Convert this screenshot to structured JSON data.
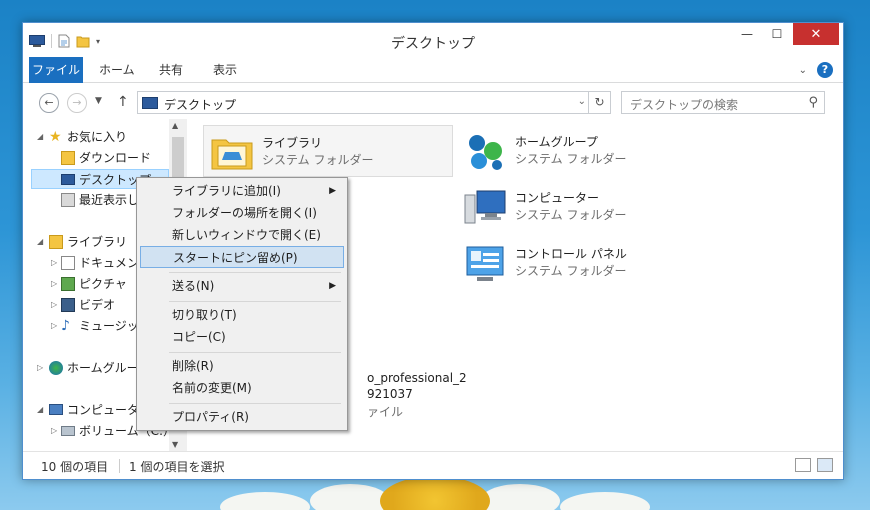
{
  "window": {
    "title": "デスクトップ"
  },
  "ribbon": {
    "tabs": [
      {
        "label": "ファイル"
      },
      {
        "label": "ホーム"
      },
      {
        "label": "共有"
      },
      {
        "label": "表示"
      }
    ],
    "help_label": "?"
  },
  "window_controls": {
    "minimize": "—",
    "maximize": "☐",
    "close": "✕"
  },
  "address_bar": {
    "path": "デスクトップ",
    "search_placeholder": "デスクトップの検索"
  },
  "nav_pane": {
    "items": [
      {
        "label": "お気に入り"
      },
      {
        "label": "ダウンロード"
      },
      {
        "label": "デスクトップ"
      },
      {
        "label": "最近表示し"
      },
      {
        "label": "ライブラリ"
      },
      {
        "label": "ドキュメント"
      },
      {
        "label": "ピクチャ"
      },
      {
        "label": "ビデオ"
      },
      {
        "label": "ミュージック"
      },
      {
        "label": "ホームグルー"
      },
      {
        "label": "コンピューター"
      },
      {
        "label": "ボリューム（C:）"
      }
    ]
  },
  "content": {
    "items": [
      {
        "name": "ライブラリ",
        "type": "システム フォルダー"
      },
      {
        "name": "ホームグループ",
        "type": "システム フォルダー"
      },
      {
        "name": "コンピューター",
        "type": "システム フォルダー"
      },
      {
        "name": "コントロール パネル",
        "type": "システム フォルダー"
      }
    ],
    "partial_file": {
      "line1": "o_professional_2",
      "line2": "921037",
      "line3": "ァイル"
    }
  },
  "context_menu": {
    "items": [
      {
        "label": "ライブラリに追加(I)"
      },
      {
        "label": "フォルダーの場所を開く(I)"
      },
      {
        "label": "新しいウィンドウで開く(E)"
      },
      {
        "label": "スタートにピン留め(P)"
      },
      {
        "label": "送る(N)"
      },
      {
        "label": "切り取り(T)"
      },
      {
        "label": "コピー(C)"
      },
      {
        "label": "削除(R)"
      },
      {
        "label": "名前の変更(M)"
      },
      {
        "label": "プロパティ(R)"
      }
    ]
  },
  "status_bar": {
    "item_count": "10 個の項目",
    "selected": "1 個の項目を選択"
  }
}
